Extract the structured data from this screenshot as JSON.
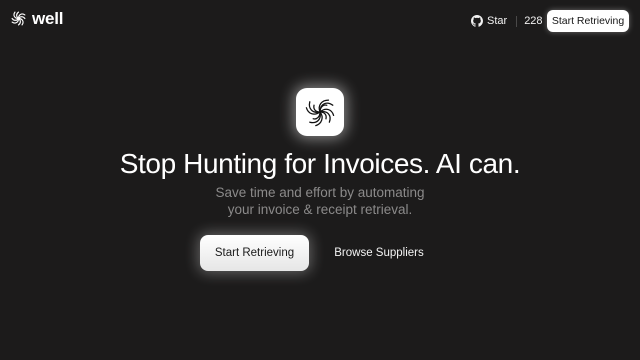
{
  "header": {
    "brand": "well",
    "github": {
      "star_label": "Star",
      "star_count": "228"
    },
    "cta_label": "Start Retrieving"
  },
  "hero": {
    "title": "Stop Hunting for Invoices. AI can.",
    "subtitle_lines": [
      "Save time and effort by automating",
      "your invoice & receipt retrieval."
    ],
    "primary_cta": "Start Retrieving",
    "secondary_cta": "Browse Suppliers"
  },
  "icons": {
    "logo": "swirl-logo-icon",
    "github": "github-icon",
    "app": "swirl-app-icon"
  },
  "colors": {
    "background": "#1c1b1b",
    "text": "#ffffff",
    "muted_text": "#8b8a8a",
    "button": "#ffffff",
    "button_text": "#151515"
  }
}
